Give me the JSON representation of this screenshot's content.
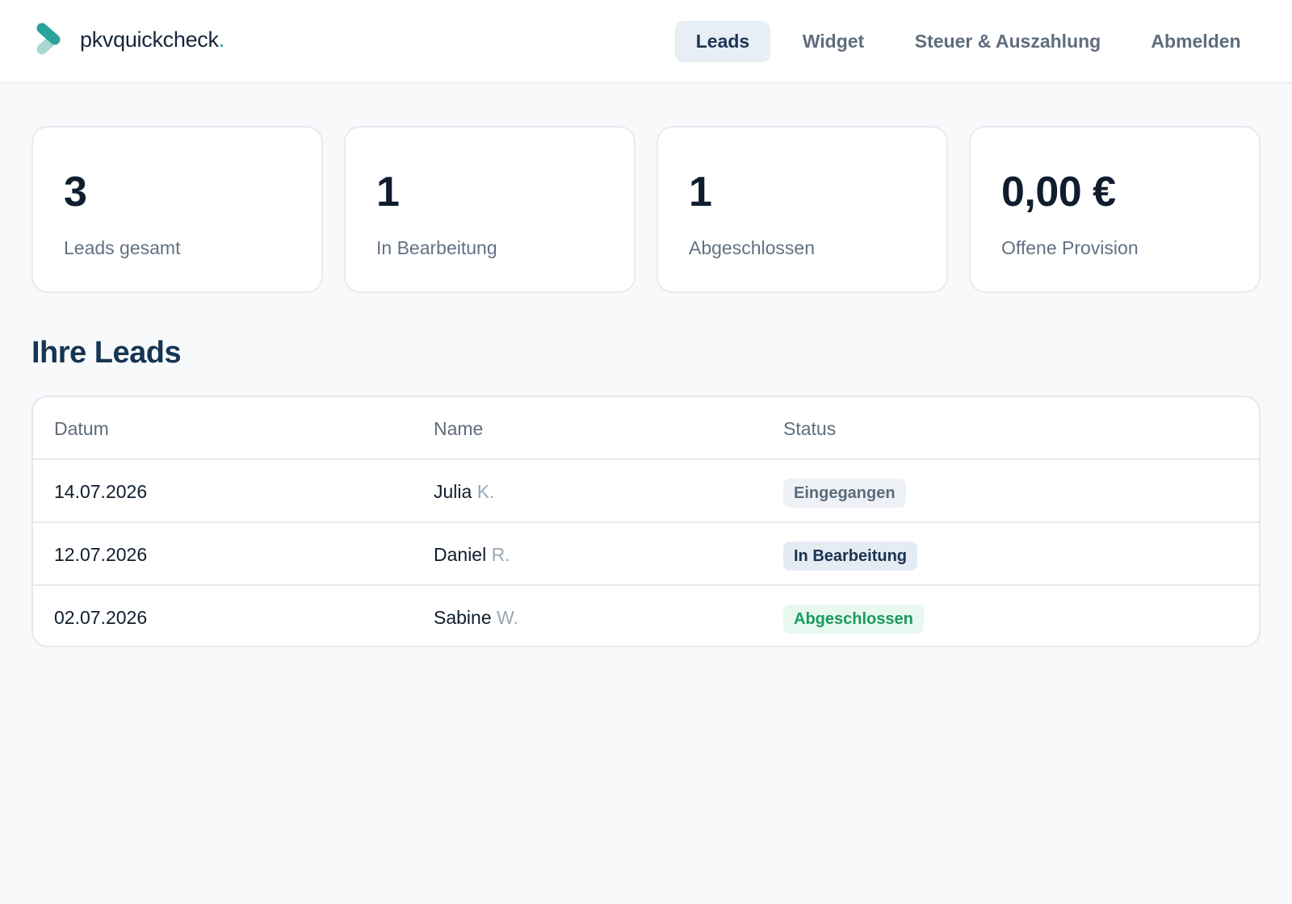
{
  "header": {
    "brand_name": "pkvquickcheck",
    "brand_dot": ".",
    "logo_icon": "chevron-logo-icon",
    "accent_color": "#2aa39a",
    "nav": [
      {
        "label": "Leads",
        "active": true
      },
      {
        "label": "Widget",
        "active": false
      },
      {
        "label": "Steuer & Auszahlung",
        "active": false
      },
      {
        "label": "Abmelden",
        "active": false
      }
    ]
  },
  "stats": [
    {
      "value": "3",
      "label": "Leads gesamt"
    },
    {
      "value": "1",
      "label": "In Bearbeitung"
    },
    {
      "value": "1",
      "label": "Abgeschlossen"
    },
    {
      "value": "0,00 €",
      "label": "Offene Provision"
    }
  ],
  "leads_section": {
    "title": "Ihre Leads",
    "columns": [
      "Datum",
      "Name",
      "Status"
    ],
    "rows": [
      {
        "date": "14.07.2026",
        "first_name": "Julia",
        "initial": "K.",
        "status": "Eingegangen",
        "status_color": "#5b6b7c"
      },
      {
        "date": "12.07.2026",
        "first_name": "Daniel",
        "initial": "R.",
        "status": "In Bearbeitung",
        "status_color": "#19324f"
      },
      {
        "date": "02.07.2026",
        "first_name": "Sabine",
        "initial": "W.",
        "status": "Abgeschlossen",
        "status_color": "#1a9a5e"
      }
    ]
  }
}
